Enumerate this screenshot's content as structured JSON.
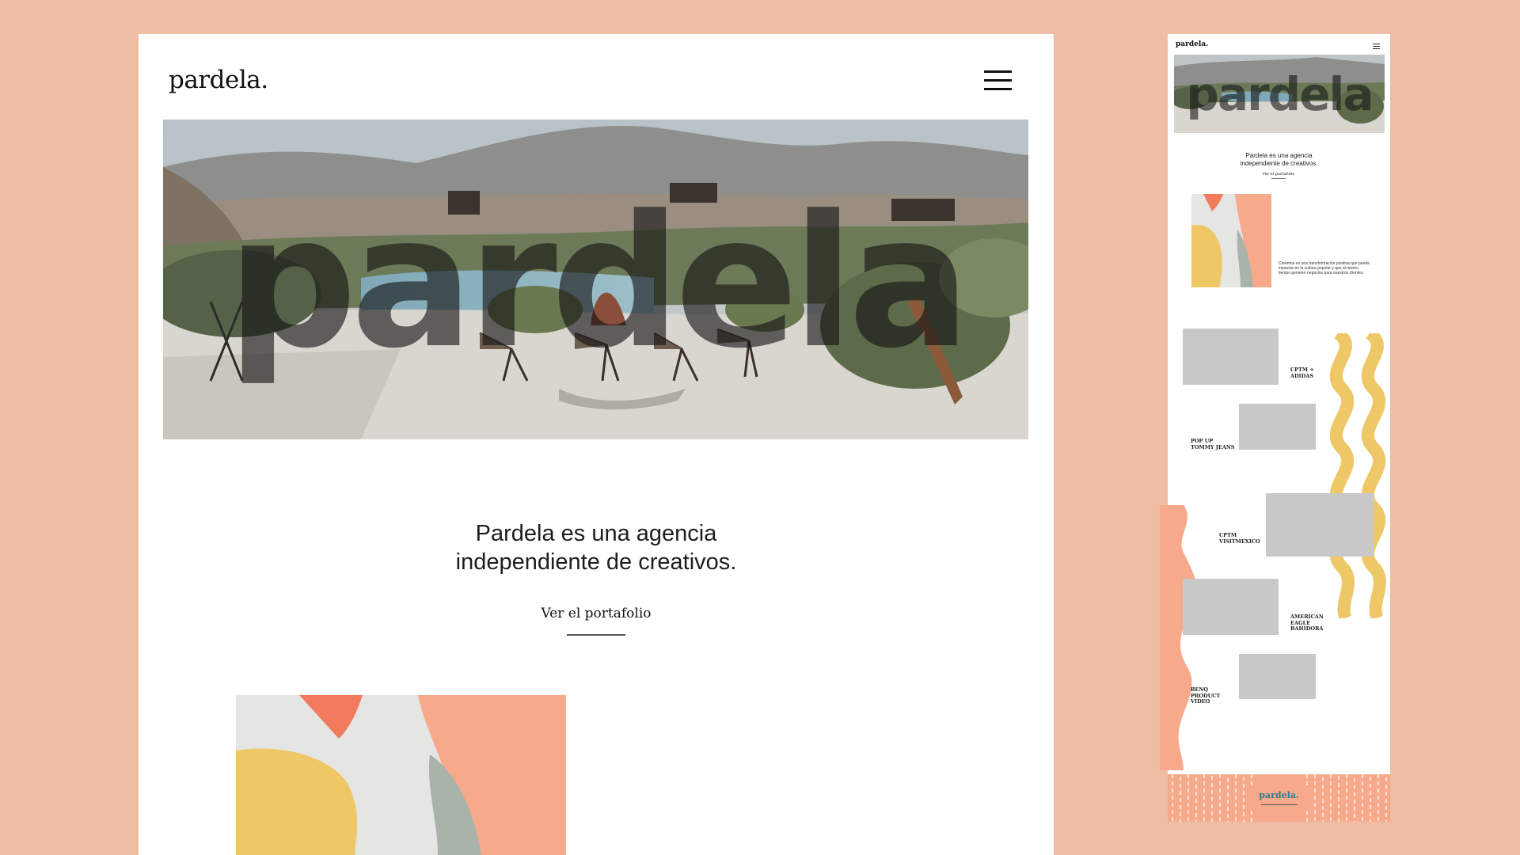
{
  "desktop": {
    "logo": "pardela.",
    "hero_word": "pardela",
    "tagline_line1": "Pardela es una agencia",
    "tagline_line2": "independiente de creativos.",
    "cta": "Ver el portafolio"
  },
  "mobile": {
    "logo": "pardela.",
    "hero_word": "pardela",
    "tagline_line1": "Pardela es una agencia",
    "tagline_line2": "independiente de creativos.",
    "cta": "Ver el portafolio",
    "belief": "Creemos en una transformación positiva que pueda impactar en la cultura popular y que al mismo tiempo generen negocios para nuestros clientes.",
    "projects": [
      "CPTM +\nADIDAS",
      "POP UP\nTOMMY JEANS",
      "CPTM\nVISITMEXICO",
      "AMERICAN\nEAGLE\nBAHIDORA",
      "BENQ\nPRODUCT\nVIDEO"
    ],
    "footer_logo": "pardela."
  },
  "colors": {
    "background": "#EEBDA3",
    "orange": "#F6A98B",
    "coral": "#F27A5E",
    "yellow": "#EEC766",
    "sage": "#A9B3AA",
    "teal": "#2C7D8C",
    "thumb_gray": "#C8C8C8"
  }
}
